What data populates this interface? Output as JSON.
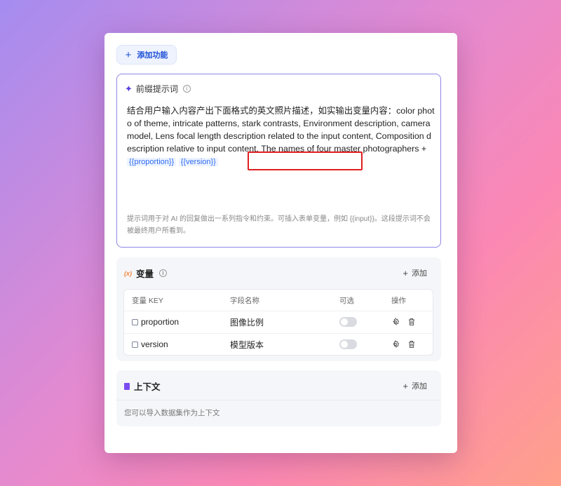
{
  "toolbar": {
    "add_feature_label": "添加功能"
  },
  "prompt": {
    "title": "前缀提示词",
    "text": "结合用户输入内容产出下面格式的英文照片描述，如实输出变量内容：color photo of theme, intricate patterns, stark contrasts, Environment description, camera model, Lens focal length description related to the input content, Composition description relative to input content, The names of four master photographers +",
    "variables": [
      "{{proportion}}",
      "{{version}}"
    ],
    "hint": "提示词用于对 AI 的回复做出一系列指令和约束。可插入表单变量，例如 {{input}}。这段提示词不会被最终用户所看到。"
  },
  "variables": {
    "title": "变量",
    "add_label": "添加",
    "columns": [
      "变量 KEY",
      "字段名称",
      "可选",
      "操作"
    ],
    "rows": [
      {
        "key": "proportion",
        "name": "图像比例",
        "optional": false
      },
      {
        "key": "version",
        "name": "模型版本",
        "optional": false
      }
    ]
  },
  "context": {
    "title": "上下文",
    "add_label": "添加",
    "description": "您可以导入数据集作为上下文"
  },
  "colors": {
    "accent": "#1d4fd6",
    "highlight": "#e0201f",
    "variable": "#2f6bf0"
  }
}
